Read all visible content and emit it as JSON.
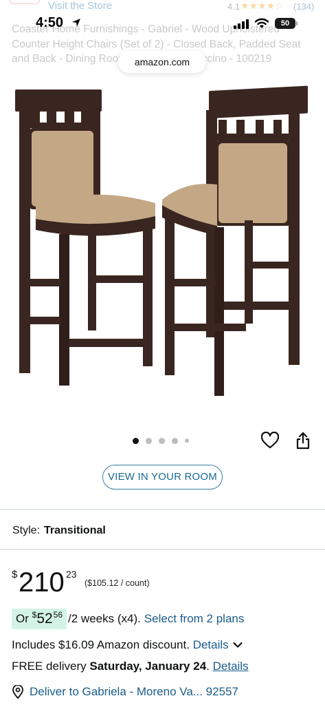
{
  "header": {
    "visit_store": "Visit the Store",
    "rating_value": "4.1",
    "rating_stars": "★★★★☆",
    "rating_count": "(134)",
    "title": "Coaster Home Furnishings - Gabriel - Wood Upholstered Counter Height Chairs (Set of 2) - Closed Back, Padded Seat and Back - Dining Room Chairs - Cappuccino - 100219"
  },
  "status_bar": {
    "time": "4:50",
    "battery": "50"
  },
  "browser": {
    "url": "amazon.com"
  },
  "gallery": {
    "dot_count": 5,
    "active_index": 0
  },
  "actions": {
    "view_in_room": "VIEW IN YOUR ROOM"
  },
  "style": {
    "label": "Style:",
    "value": "Transitional"
  },
  "price": {
    "currency": "$",
    "whole": "210",
    "fraction": "23",
    "per_count": "($105.12 / count)"
  },
  "installments": {
    "prefix": "Or",
    "currency": "$",
    "whole": "52",
    "fraction": "56",
    "term": "/2 weeks (x4).",
    "link": "Select from 2 plans"
  },
  "discount": {
    "text": "Includes $16.09 Amazon discount.",
    "link": "Details"
  },
  "delivery": {
    "prefix": "FREE delivery",
    "date": "Saturday, January 24",
    "suffix": ".",
    "link": "Details"
  },
  "deliver_to": {
    "text": "Deliver to Gabriela - Moreno Va... 92557"
  },
  "colors": {
    "link": "#1a5c8a",
    "badge_bg": "#d4f3e7",
    "chair_wood": "#3a2620",
    "chair_fabric": "#c4a886"
  }
}
